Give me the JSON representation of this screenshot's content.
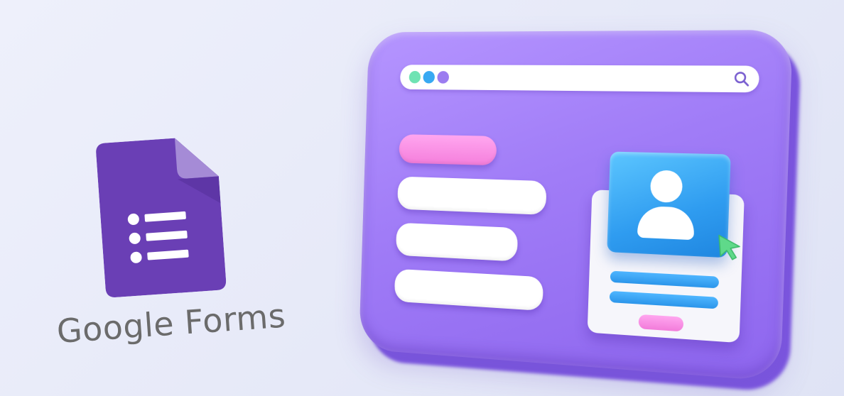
{
  "brand": {
    "wordmark": "Google Forms",
    "icon": "google-forms-document-icon",
    "colors": {
      "icon_purple": "#6a3fb5",
      "icon_fold": "#a58bd6",
      "wordmark_gray": "#6b6b6b"
    }
  },
  "illustration": {
    "window_color": "#a07cf7",
    "address_bar": {
      "dots": [
        "#6fe3b3",
        "#38a9f2",
        "#9b7cf0"
      ],
      "icon": "search-icon"
    },
    "form_pills": [
      "pink-pill",
      "white-pill",
      "white-pill",
      "white-pill"
    ],
    "profile_card": {
      "icon": "user-avatar-icon",
      "cursor_icon": "cursor-arrow-icon",
      "accent_blue": "#2f9cf0",
      "accent_pink": "#f57fdc",
      "cursor_green": "#5fd98a"
    }
  }
}
